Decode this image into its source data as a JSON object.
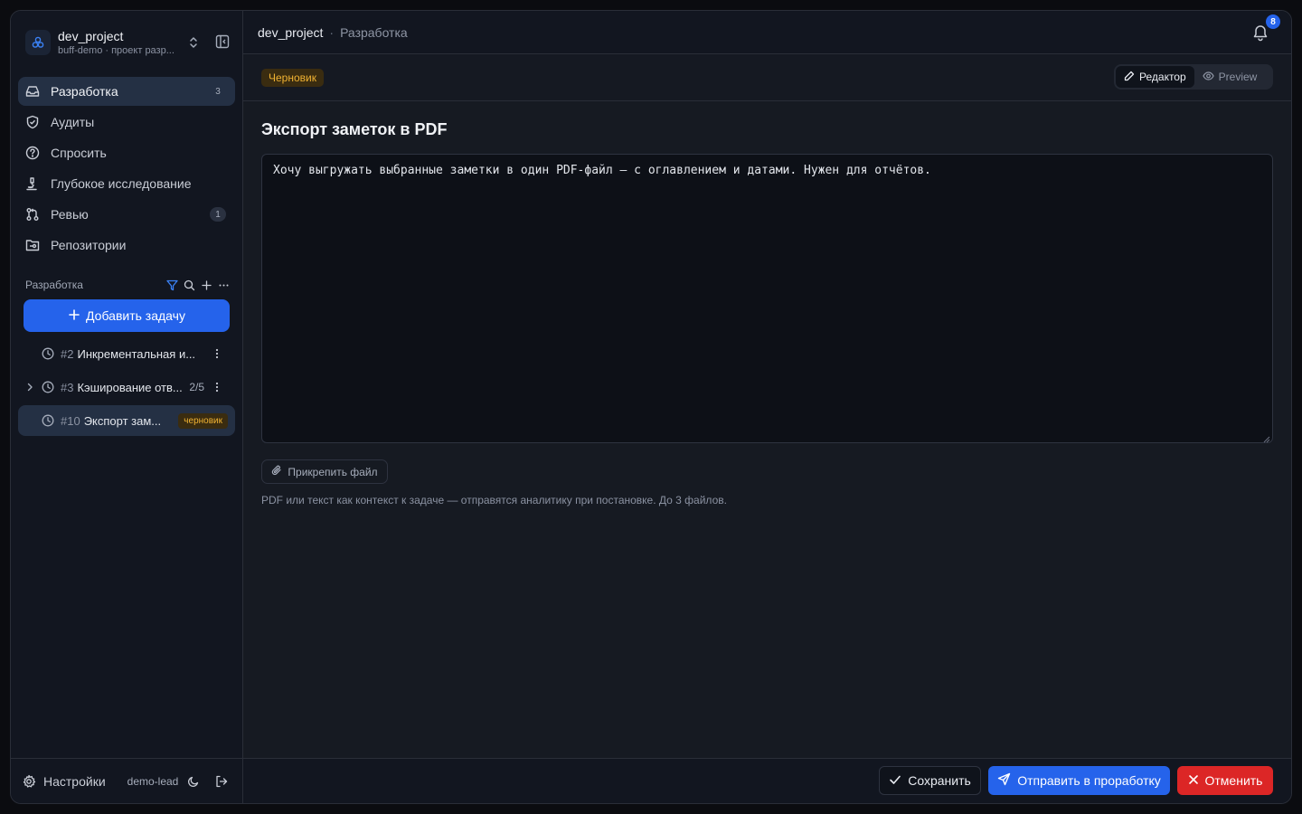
{
  "project": {
    "name": "dev_project",
    "subtitle": "buff-demo · проект разр..."
  },
  "nav": [
    {
      "label": "Разработка",
      "badge": "3",
      "icon": "inbox-icon",
      "active": true
    },
    {
      "label": "Аудиты",
      "badge": "",
      "icon": "shield-check-icon"
    },
    {
      "label": "Спросить",
      "badge": "",
      "icon": "help-circle-icon"
    },
    {
      "label": "Глубокое исследование",
      "badge": "",
      "icon": "microscope-icon"
    },
    {
      "label": "Ревью",
      "badge": "1",
      "icon": "git-pull-request-icon"
    },
    {
      "label": "Репозитории",
      "badge": "",
      "icon": "folder-git-icon"
    }
  ],
  "section": {
    "title": "Разработка",
    "add_task_label": "Добавить задачу"
  },
  "tasks": [
    {
      "num": "#2",
      "title": "Инкрементальная и...",
      "count": "",
      "badge": "",
      "expandable": false
    },
    {
      "num": "#3",
      "title": "Кэширование отв...",
      "count": "2/5",
      "badge": "",
      "expandable": true
    },
    {
      "num": "#10",
      "title": "Экспорт зам...",
      "count": "",
      "badge": "черновик",
      "expandable": false,
      "active": true
    }
  ],
  "footer": {
    "settings_label": "Настройки",
    "user": "demo-lead"
  },
  "topbar": {
    "project": "dev_project",
    "separator": "·",
    "page": "Разработка",
    "notifications": "8"
  },
  "subbar": {
    "status": "Черновик",
    "editor_label": "Редактор",
    "preview_label": "Preview"
  },
  "main": {
    "title": "Экспорт заметок в PDF",
    "body": "Хочу выгружать выбранные заметки в один PDF-файл — с оглавлением и датами. Нужен для отчётов.",
    "attach_label": "Прикрепить файл",
    "hint": "PDF или текст как контекст к задаче — отправятся аналитику при постановке. До 3 файлов."
  },
  "actions": {
    "save": "Сохранить",
    "send": "Отправить в проработку",
    "cancel": "Отменить"
  },
  "colors": {
    "accent": "#2563eb",
    "danger": "#dc2626",
    "draft": "#f0b232"
  }
}
